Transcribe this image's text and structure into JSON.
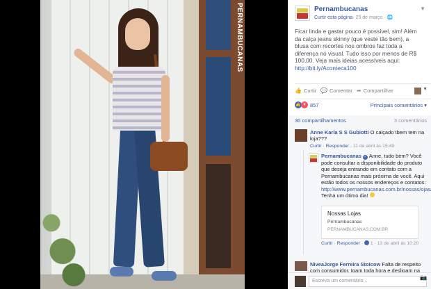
{
  "photo": {
    "brand_vertical": "PERNAMBUCANAS"
  },
  "post": {
    "page_name": "Pernambucanas",
    "follow_link": "Curtir esta página",
    "date": "· 25 de março · ",
    "globe_icon": "globe-icon",
    "body_text": "Ficar linda e gastar pouco é possível, sim! Além da calça jeans skinny (que veste tão bem), a blusa com recortes nos ombros faz toda a diferença no visual. Tudo isso por menos de R$ 100,00. Veja mais ideias acessíveis aqui:",
    "body_link": "http://bit.ly/Aconteca100"
  },
  "actions": {
    "like": "Curtir",
    "comment": "Comentar",
    "share": "Compartilhar"
  },
  "reactions": {
    "count": "857",
    "relevant_label": "Principais comentários"
  },
  "stats": {
    "shares": "30 compartilhamentos",
    "comments": "3 comentários"
  },
  "comments": [
    {
      "author": "Anne Karla S S Gubiotti",
      "text": " O calçado tbem tem na loja???",
      "reply": "Curtir",
      "respond": "Responder",
      "time": "· 11 de abril às 15:49"
    },
    {
      "author": "Pernambucanas",
      "text": " Anne, tudo bem? Você pode consultar a disponibilidade do produto que deseja entrando em contato com a Pernambucanas mais próxima de você. Aqui estão todos os nossos endereços e contatos: ",
      "link": "http://www.pernambucanas.com.br/nossas/ojas/",
      "text_after": ". Tenha um ótimo dia! ",
      "preview_title": "Nossas Lojas",
      "preview_desc": "Pernambucanas",
      "preview_url": "PERNAMBUCANAS.COM.BR",
      "reply": "Curtir",
      "respond": "Responder",
      "likes": "1",
      "time": "· 13 de abril às 10:20"
    },
    {
      "author": "NiveaJorge Ferreira Stoicow",
      "text": " Falta de respeito com consumidor, Igam toda hora e desligam na"
    }
  ],
  "composer": {
    "placeholder": "Escreva um comentário..."
  },
  "colors": {
    "link": "#365899",
    "like": "#4267b2",
    "love": "#f25268"
  }
}
